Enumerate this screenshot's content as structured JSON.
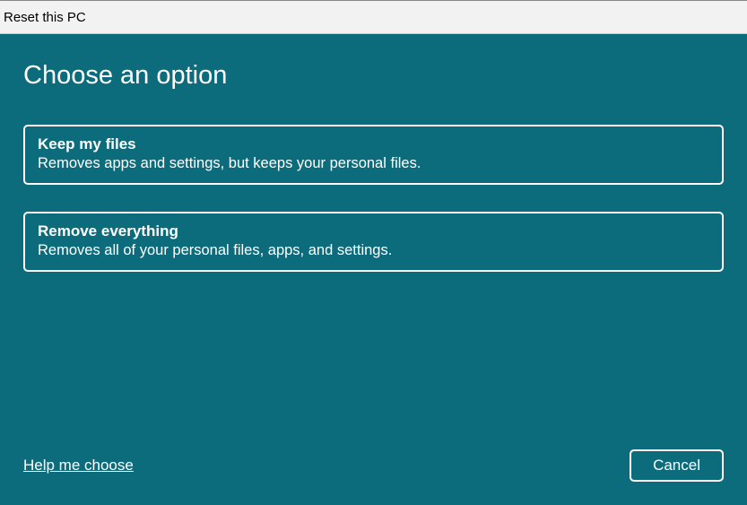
{
  "window": {
    "title": "Reset this PC"
  },
  "page": {
    "title": "Choose an option"
  },
  "options": [
    {
      "title": "Keep my files",
      "description": "Removes apps and settings, but keeps your personal files."
    },
    {
      "title": "Remove everything",
      "description": "Removes all of your personal files, apps, and settings."
    }
  ],
  "footer": {
    "help_link": "Help me choose",
    "cancel_label": "Cancel"
  }
}
